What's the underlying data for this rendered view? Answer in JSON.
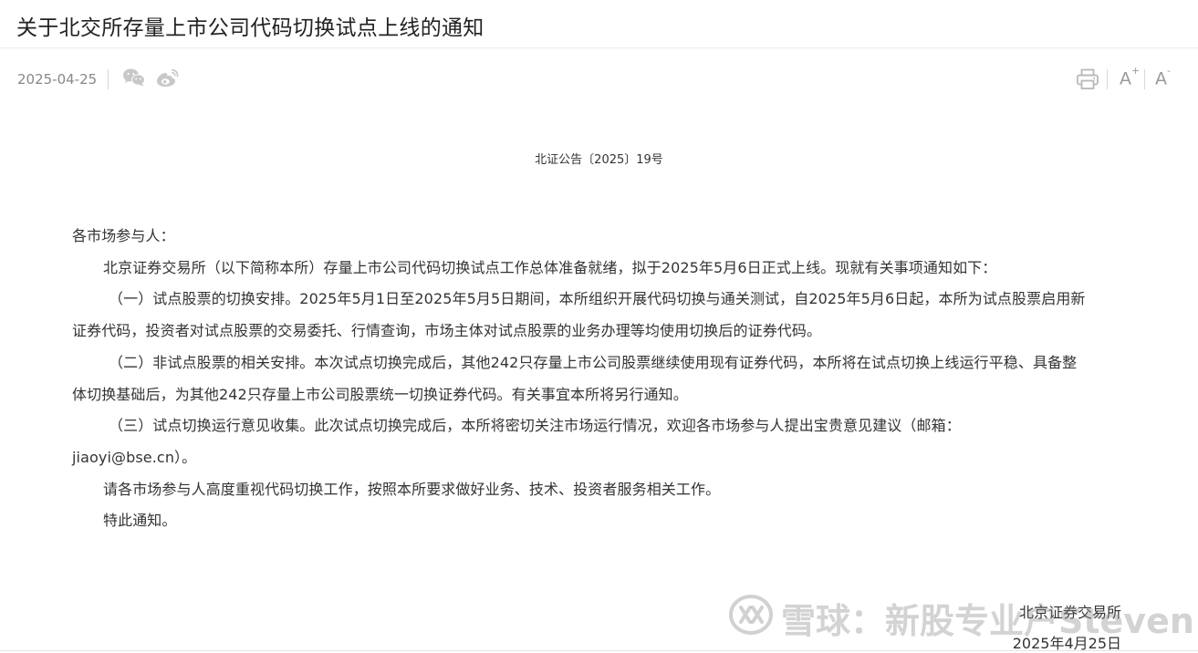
{
  "header": {
    "title": "关于北交所存量上市公司代码切换试点上线的通知"
  },
  "meta": {
    "date": "2025-04-25",
    "share_icons": [
      "wechat-icon",
      "weibo-icon"
    ],
    "tools": [
      "print-icon",
      "font-increase",
      "font-decrease"
    ],
    "font_increase_label": "A",
    "font_increase_sup": "+",
    "font_decrease_label": "A",
    "font_decrease_sup": "-"
  },
  "article": {
    "doc_number": "北证公告〔2025〕19号",
    "salutation": "各市场参与人：",
    "lines": [
      "北京证券交易所（以下简称本所）存量上市公司代码切换试点工作总体准备就绪，拟于2025年5月6日正式上线。现就有关事项通知如下：",
      "（一）试点股票的切换安排。2025年5月1日至2025年5月5日期间，本所组织开展代码切换与通关测试，自2025年5月6日起，本所为试点股票启用新",
      "证券代码，投资者对试点股票的交易委托、行情查询，市场主体对试点股票的业务办理等均使用切换后的证券代码。",
      "（二）非试点股票的相关安排。本次试点切换完成后，其他242只存量上市公司股票继续使用现有证券代码，本所将在试点切换上线运行平稳、具备整",
      "体切换基础后，为其他242只存量上市公司股票统一切换证券代码。有关事宜本所将另行通知。",
      "（三）试点切换运行意见收集。此次试点切换完成后，本所将密切关注市场运行情况，欢迎各市场参与人提出宝贵意见建议（邮箱：",
      "jiaoyi@bse.cn）。",
      "请各市场参与人高度重视代码切换工作，按照本所要求做好业务、技术、投资者服务相关工作。",
      "特此通知。"
    ],
    "signature": "北京证券交易所",
    "signature_date": "2025年4月25日"
  },
  "watermark": {
    "text": "雪球：新股专业户Steven"
  },
  "colors": {
    "title": "#222222",
    "body_text": "#333333",
    "meta_text": "#888888",
    "icon": "#b5b5b5"
  }
}
